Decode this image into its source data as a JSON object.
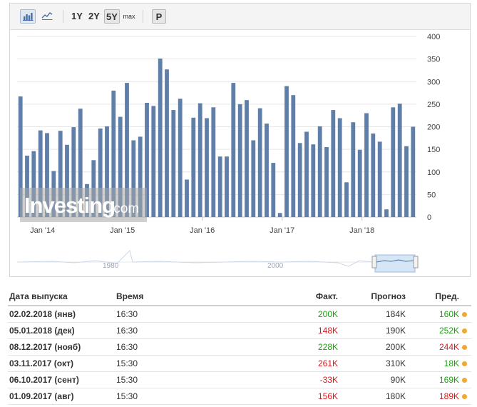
{
  "toolbar": {
    "chart_icons": [
      "bar-chart-icon",
      "line-chart-icon"
    ],
    "periods": [
      "1Y",
      "2Y",
      "5Y",
      "max"
    ],
    "active_period": "5Y",
    "extra_button": "P"
  },
  "chart_data": {
    "type": "bar",
    "ylim": [
      0,
      400
    ],
    "y_ticks": [
      0,
      50,
      100,
      150,
      200,
      250,
      300,
      350,
      400
    ],
    "x_tick_labels": [
      "Jan '14",
      "Jan '15",
      "Jan '16",
      "Jan '17",
      "Jan '18"
    ],
    "values": [
      267,
      136,
      146,
      192,
      186,
      102,
      191,
      160,
      199,
      240,
      73,
      126,
      196,
      201,
      280,
      222,
      297,
      170,
      178,
      253,
      246,
      351,
      327,
      237,
      262,
      83,
      220,
      252,
      219,
      243,
      134,
      134,
      297,
      250,
      259,
      170,
      241,
      207,
      120,
      9,
      290,
      270,
      164,
      189,
      161,
      201,
      155,
      237,
      219,
      77,
      210,
      149,
      230,
      185,
      167,
      17,
      243,
      251,
      157,
      200
    ],
    "color": "#5f7ea8",
    "grid": true
  },
  "watermark": {
    "brand": "Investing",
    "suffix": ".com"
  },
  "navigator": {
    "labels": [
      "1980",
      "2000"
    ]
  },
  "table": {
    "headers": {
      "date": "Дата выпуска",
      "time": "Время",
      "actual": "Факт.",
      "forecast": "Прогноз",
      "previous": "Пред."
    },
    "rows": [
      {
        "date": "02.02.2018 (янв)",
        "time": "16:30",
        "actual": "200K",
        "actual_status": "positive",
        "forecast": "184K",
        "previous": "160K",
        "previous_status": "positive"
      },
      {
        "date": "05.01.2018 (дек)",
        "time": "16:30",
        "actual": "148K",
        "actual_status": "negative",
        "forecast": "190K",
        "previous": "252K",
        "previous_status": "positive"
      },
      {
        "date": "08.12.2017 (нояб)",
        "time": "16:30",
        "actual": "228K",
        "actual_status": "positive",
        "forecast": "200K",
        "previous": "244K",
        "previous_status": "negative"
      },
      {
        "date": "03.11.2017 (окт)",
        "time": "15:30",
        "actual": "261K",
        "actual_status": "negative",
        "forecast": "310K",
        "previous": "18K",
        "previous_status": "positive"
      },
      {
        "date": "06.10.2017 (сент)",
        "time": "15:30",
        "actual": "-33K",
        "actual_status": "negative",
        "forecast": "90K",
        "previous": "169K",
        "previous_status": "positive"
      },
      {
        "date": "01.09.2017 (авг)",
        "time": "15:30",
        "actual": "156K",
        "actual_status": "negative",
        "forecast": "180K",
        "previous": "189K",
        "previous_status": "negative"
      }
    ],
    "importance_color": "#f0a830"
  }
}
